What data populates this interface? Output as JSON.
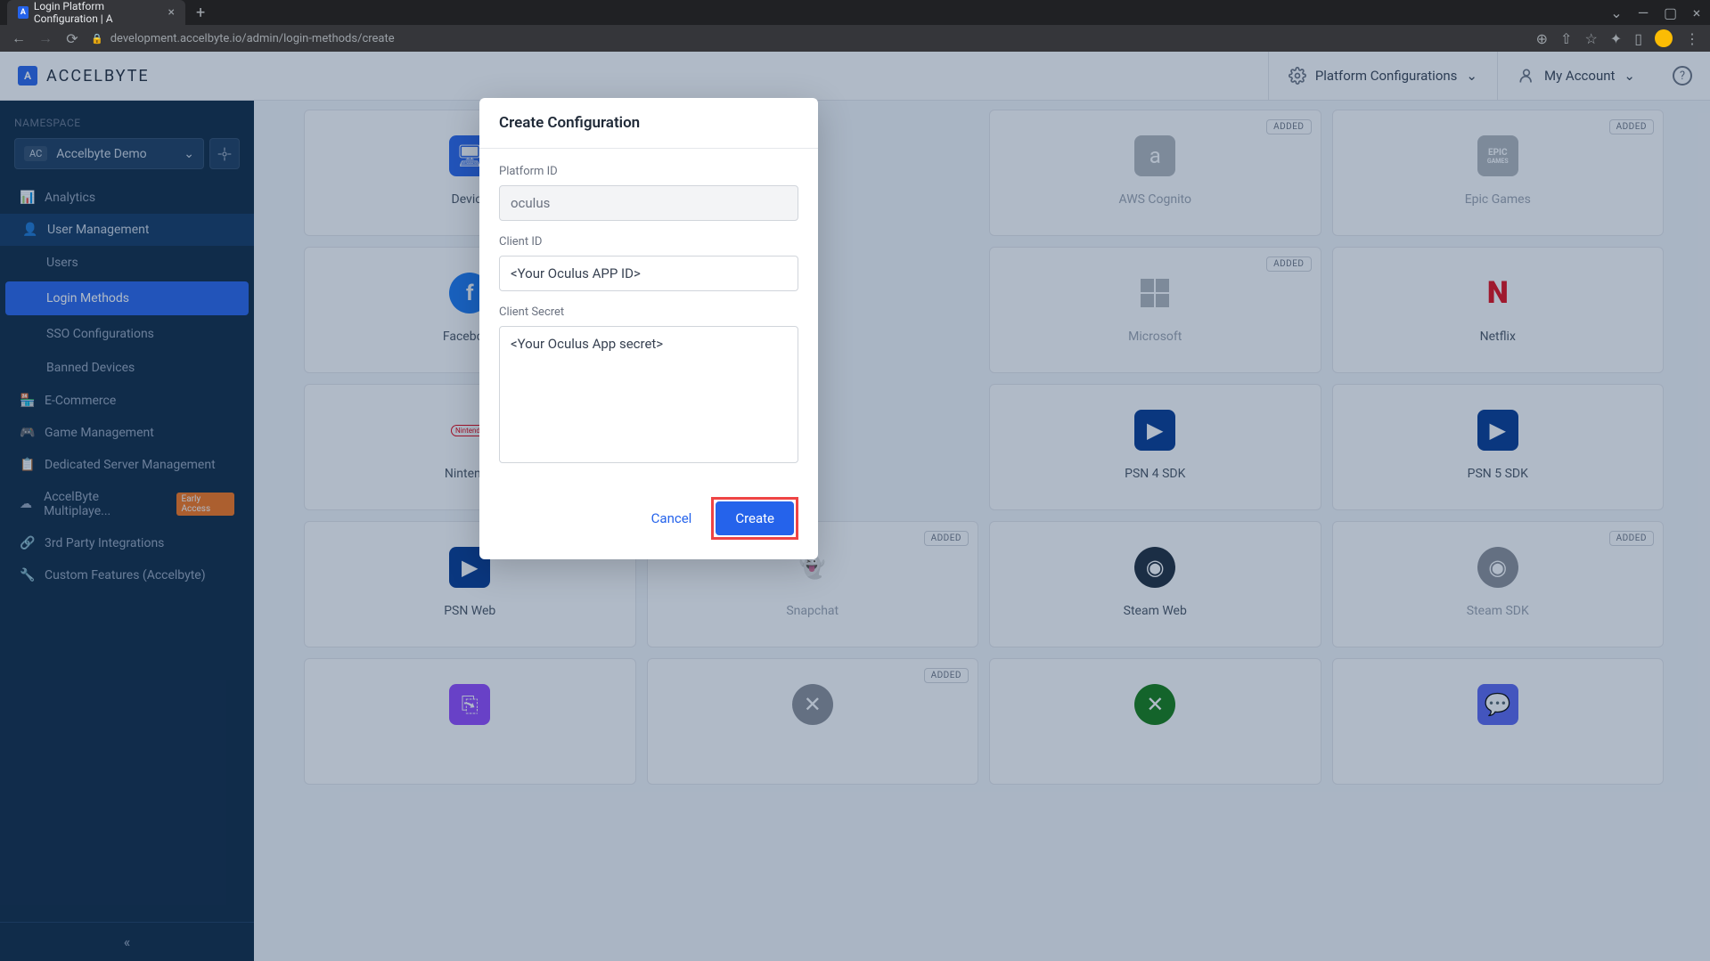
{
  "browser": {
    "tab_title": "Login Platform Configuration | A",
    "url": "development.accelbyte.io/admin/login-methods/create"
  },
  "header": {
    "brand": "ACCELBYTE",
    "platform_config": "Platform Configurations",
    "my_account": "My Account"
  },
  "sidebar": {
    "namespace_label": "NAMESPACE",
    "namespace_value": "Accelbyte Demo",
    "ns_badge": "AC",
    "items": {
      "analytics": "Analytics",
      "user_mgmt": "User Management",
      "users": "Users",
      "login_methods": "Login Methods",
      "sso": "SSO Configurations",
      "banned": "Banned Devices",
      "ecommerce": "E-Commerce",
      "game_mgmt": "Game Management",
      "dedicated": "Dedicated Server Management",
      "multiplayer": "AccelByte Multiplaye...",
      "early_access": "Early Access",
      "third_party": "3rd Party Integrations",
      "custom": "Custom Features (Accelbyte)"
    }
  },
  "cards": {
    "added_badge": "ADDED",
    "device": "Device",
    "aws": "AWS Cognito",
    "epic": "Epic Games",
    "facebook": "Facebook",
    "microsoft": "Microsoft",
    "netflix": "Netflix",
    "nintendo": "Nintendo",
    "nintendo_chip": "Nintendo",
    "psn4": "PSN 4 SDK",
    "psn5": "PSN 5 SDK",
    "psn_web": "PSN Web",
    "snapchat": "Snapchat",
    "steam_web": "Steam Web",
    "steam_sdk": "Steam SDK",
    "epic_small": "EPIC",
    "epic_sub": "GAMES"
  },
  "modal": {
    "title": "Create Configuration",
    "platform_id_label": "Platform ID",
    "platform_id_value": "oculus",
    "client_id_label": "Client ID",
    "client_id_value": "<Your Oculus APP ID>",
    "client_secret_label": "Client Secret",
    "client_secret_value": "<Your Oculus App secret>",
    "cancel": "Cancel",
    "create": "Create"
  }
}
